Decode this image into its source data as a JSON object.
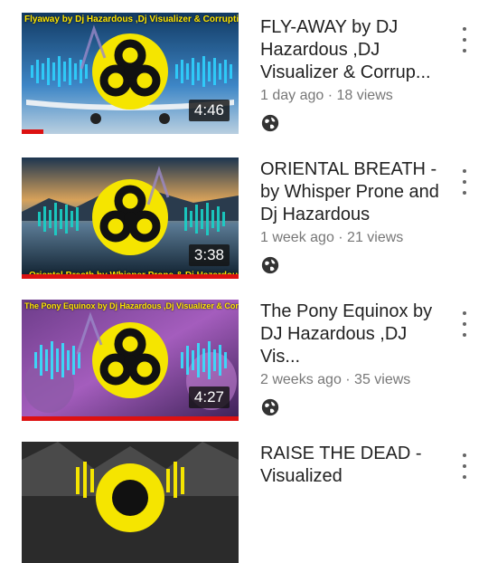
{
  "videos": [
    {
      "thumb_title": "Flyaway by Dj Hazardous ,Dj Visualizer & Corruption",
      "thumb_bottom": "",
      "duration": "4:46",
      "title": "FLY-AWAY by DJ Hazardous ,DJ Visualizer & Corrup...",
      "meta": "1 day ago · 18 views",
      "watched_fraction": 0.1,
      "palette": "sky"
    },
    {
      "thumb_title": "",
      "thumb_bottom": "Oriental Breath by Whisper Prone & Dj Hazardous",
      "duration": "3:38",
      "title": "ORIENTAL BREATH - by Whisper Prone and Dj Hazardous",
      "meta": "1 week ago · 21 views",
      "watched_fraction": 1.0,
      "palette": "sunset"
    },
    {
      "thumb_title": "The Pony Equinox by Dj Hazardous ,Dj Visualizer & Corruption",
      "thumb_bottom": "",
      "duration": "4:27",
      "title": "The Pony Equinox by DJ Hazardous ,DJ Vis...",
      "meta": "2 weeks ago · 35 views",
      "watched_fraction": 1.0,
      "palette": "purple"
    },
    {
      "thumb_title": "",
      "thumb_bottom": "",
      "duration": "",
      "title": "RAISE THE DEAD - Visualized",
      "meta": "",
      "watched_fraction": 0,
      "palette": "dark"
    }
  ],
  "icons": {
    "visibility": "globe-icon",
    "menu": "more-vert-icon"
  },
  "colors": {
    "progress": "#dd1111",
    "badge_yellow": "#f5e500",
    "title_text": "#222222",
    "meta_text": "#777777"
  }
}
